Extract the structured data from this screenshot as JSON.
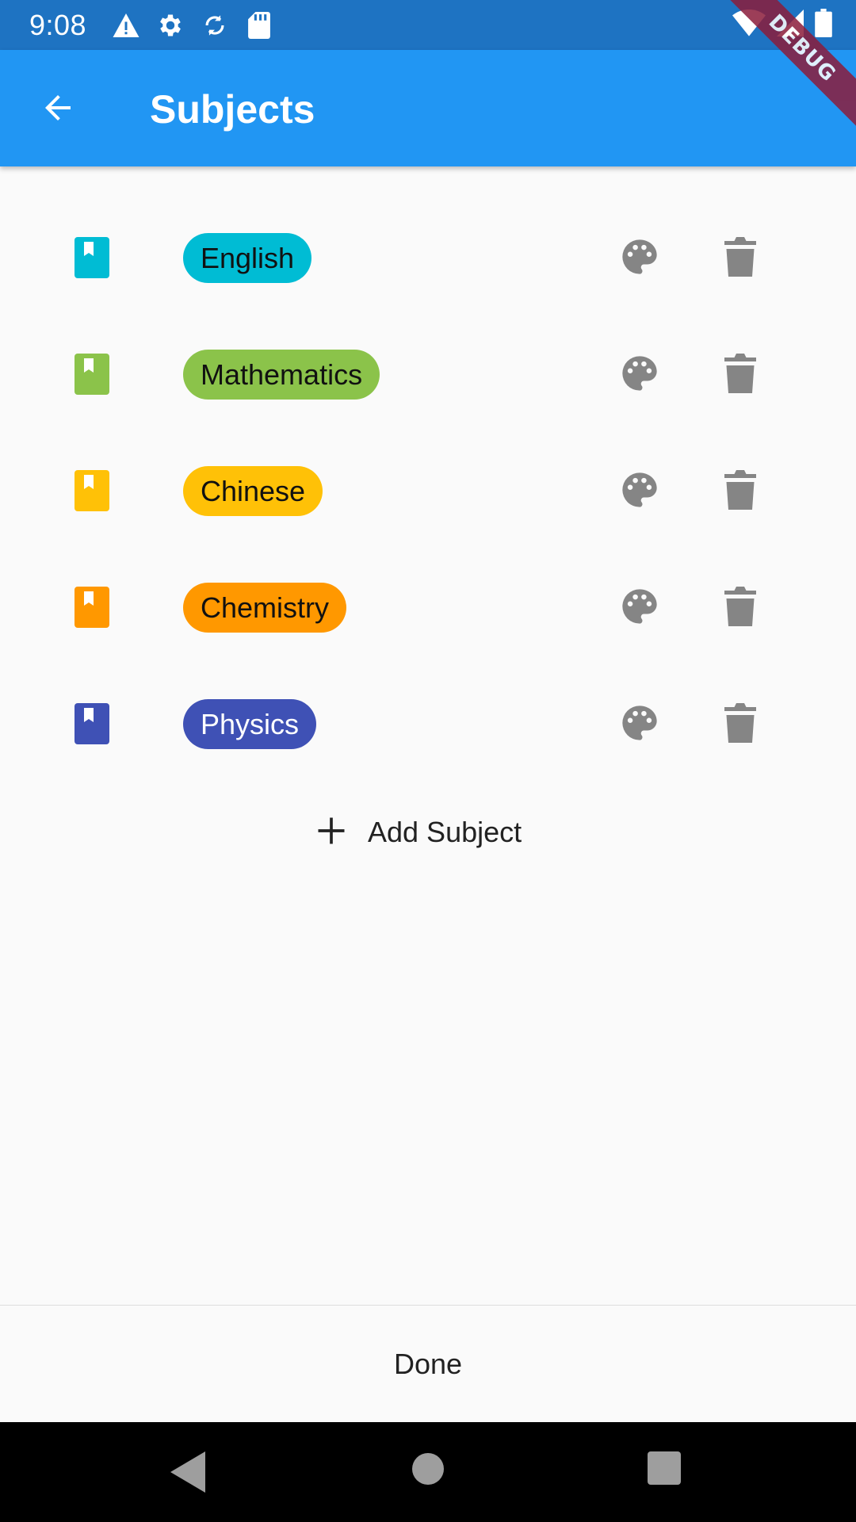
{
  "status_bar": {
    "time": "9:08",
    "icons": [
      "warning-icon",
      "settings-icon",
      "sync-icon",
      "sd-card-icon",
      "wifi-icon",
      "signal-icon",
      "battery-icon"
    ]
  },
  "app_bar": {
    "title": "Subjects",
    "back_icon": "arrow-back-icon",
    "color": "#2196f3"
  },
  "debug_banner": "DEBUG",
  "subjects": [
    {
      "label": "English",
      "color": "#00bcd4",
      "text_color": "#111111"
    },
    {
      "label": "Mathematics",
      "color": "#8bc34a",
      "text_color": "#111111"
    },
    {
      "label": "Chinese",
      "color": "#ffc107",
      "text_color": "#111111"
    },
    {
      "label": "Chemistry",
      "color": "#ff9800",
      "text_color": "#111111"
    },
    {
      "label": "Physics",
      "color": "#3f51b5",
      "text_color": "#ffffff"
    }
  ],
  "row_actions": {
    "palette_icon": "palette-icon",
    "delete_icon": "delete-icon",
    "icon_color": "#858585"
  },
  "add_subject": {
    "label": "Add Subject",
    "icon": "add-icon"
  },
  "done_button": {
    "label": "Done"
  }
}
